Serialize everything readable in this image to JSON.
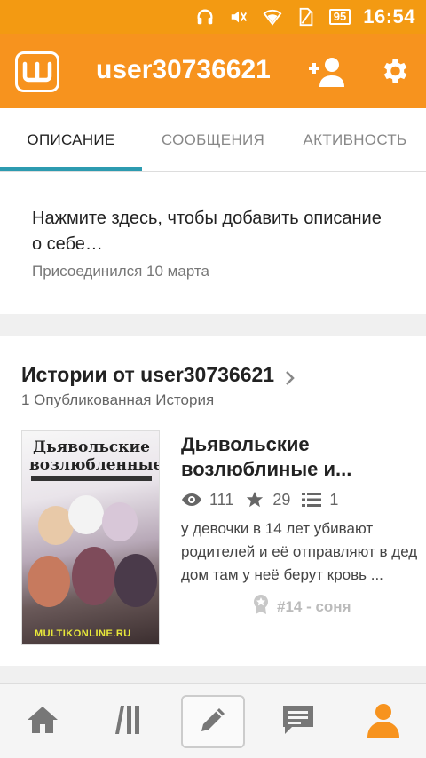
{
  "status_bar": {
    "battery": "95",
    "time": "16:54"
  },
  "app_bar": {
    "username": "user30736621"
  },
  "tabs": [
    {
      "label": "ОПИСАНИЕ",
      "active": true
    },
    {
      "label": "СООБЩЕНИЯ",
      "active": false
    },
    {
      "label": "АКТИВНОСТЬ",
      "active": false
    }
  ],
  "description": {
    "prompt": "Нажмите здесь, чтобы добавить описание о себе…",
    "joined": "Присоединился 10 марта"
  },
  "stories": {
    "title": "Истории от user30736621",
    "subtitle": "1 Опубликованная История",
    "items": [
      {
        "cover_title": "Дьявольские возлюбленные",
        "cover_watermark": "MULTIKONLINE.RU",
        "title": "Дьявольские возлюблиные и...",
        "views": "111",
        "votes": "29",
        "parts": "1",
        "description": "у девочки в 14 лет убивают родителей и её отправляют в дед дом там у неё берут кровь ...",
        "rank": "#14 - соня"
      }
    ]
  },
  "colors": {
    "brand": "#f7931e",
    "accent": "#2d9bb0"
  }
}
